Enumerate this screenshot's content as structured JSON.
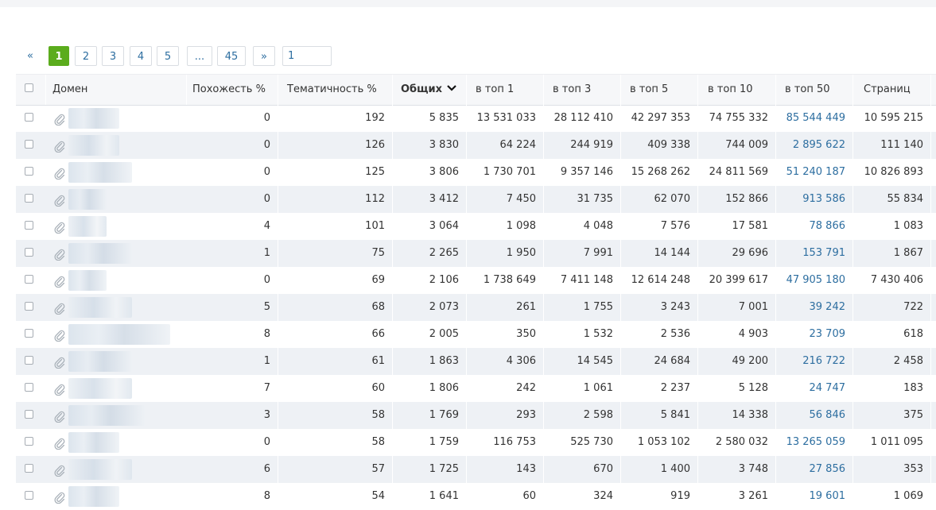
{
  "pagination": {
    "prev": "«",
    "pages": [
      "1",
      "2",
      "3",
      "4",
      "5",
      "...",
      "45"
    ],
    "active": "1",
    "next": "»",
    "goto_value": "1"
  },
  "table": {
    "columns": [
      "Домен",
      "Похожесть %",
      "Тематичность %",
      "Общих",
      "в топ 1",
      "в топ 3",
      "в топ 5",
      "в топ 10",
      "в топ 50",
      "Страниц"
    ],
    "rows": [
      [
        "0",
        "192",
        "5 835",
        "13 531 033",
        "28 112 410",
        "42 297 353",
        "74 755 332",
        "85 544 449",
        "10 595 215"
      ],
      [
        "0",
        "126",
        "3 830",
        "64 224",
        "244 919",
        "409 338",
        "744 009",
        "2 895 622",
        "111 140"
      ],
      [
        "0",
        "125",
        "3 806",
        "1 730 701",
        "9 357 146",
        "15 268 262",
        "24 811 569",
        "51 240 187",
        "10 826 893"
      ],
      [
        "0",
        "112",
        "3 412",
        "7 450",
        "31 735",
        "62 070",
        "152 866",
        "913 586",
        "55 834"
      ],
      [
        "4",
        "101",
        "3 064",
        "1 098",
        "4 048",
        "7 576",
        "17 581",
        "78 866",
        "1 083"
      ],
      [
        "1",
        "75",
        "2 265",
        "1 950",
        "7 991",
        "14 144",
        "29 696",
        "153 791",
        "1 867"
      ],
      [
        "0",
        "69",
        "2 106",
        "1 738 649",
        "7 411 148",
        "12 614 248",
        "20 399 617",
        "47 905 180",
        "7 430 406"
      ],
      [
        "5",
        "68",
        "2 073",
        "261",
        "1 755",
        "3 243",
        "7 001",
        "39 242",
        "722"
      ],
      [
        "8",
        "66",
        "2 005",
        "350",
        "1 532",
        "2 536",
        "4 903",
        "23 709",
        "618"
      ],
      [
        "1",
        "61",
        "1 863",
        "4 306",
        "14 545",
        "24 684",
        "49 200",
        "216 722",
        "2 458"
      ],
      [
        "7",
        "60",
        "1 806",
        "242",
        "1 061",
        "2 237",
        "5 128",
        "24 747",
        "183"
      ],
      [
        "3",
        "58",
        "1 769",
        "293",
        "2 598",
        "5 841",
        "14 338",
        "56 846",
        "375"
      ],
      [
        "0",
        "58",
        "1 759",
        "116 753",
        "525 730",
        "1 053 102",
        "2 580 032",
        "13 265 059",
        "1 011 095"
      ],
      [
        "6",
        "57",
        "1 725",
        "143",
        "670",
        "1 400",
        "3 748",
        "27 856",
        "353"
      ],
      [
        "8",
        "54",
        "1 641",
        "60",
        "324",
        "919",
        "3 261",
        "19 601",
        "1 069"
      ]
    ]
  },
  "colors": {
    "active_page": "#5bac1d",
    "link": "#2d6ea0",
    "alt_row": "#eef1f5"
  },
  "icons": {
    "checkbox": "checkbox",
    "attach": "paperclip-icon",
    "sort": "chevron-down-icon"
  }
}
